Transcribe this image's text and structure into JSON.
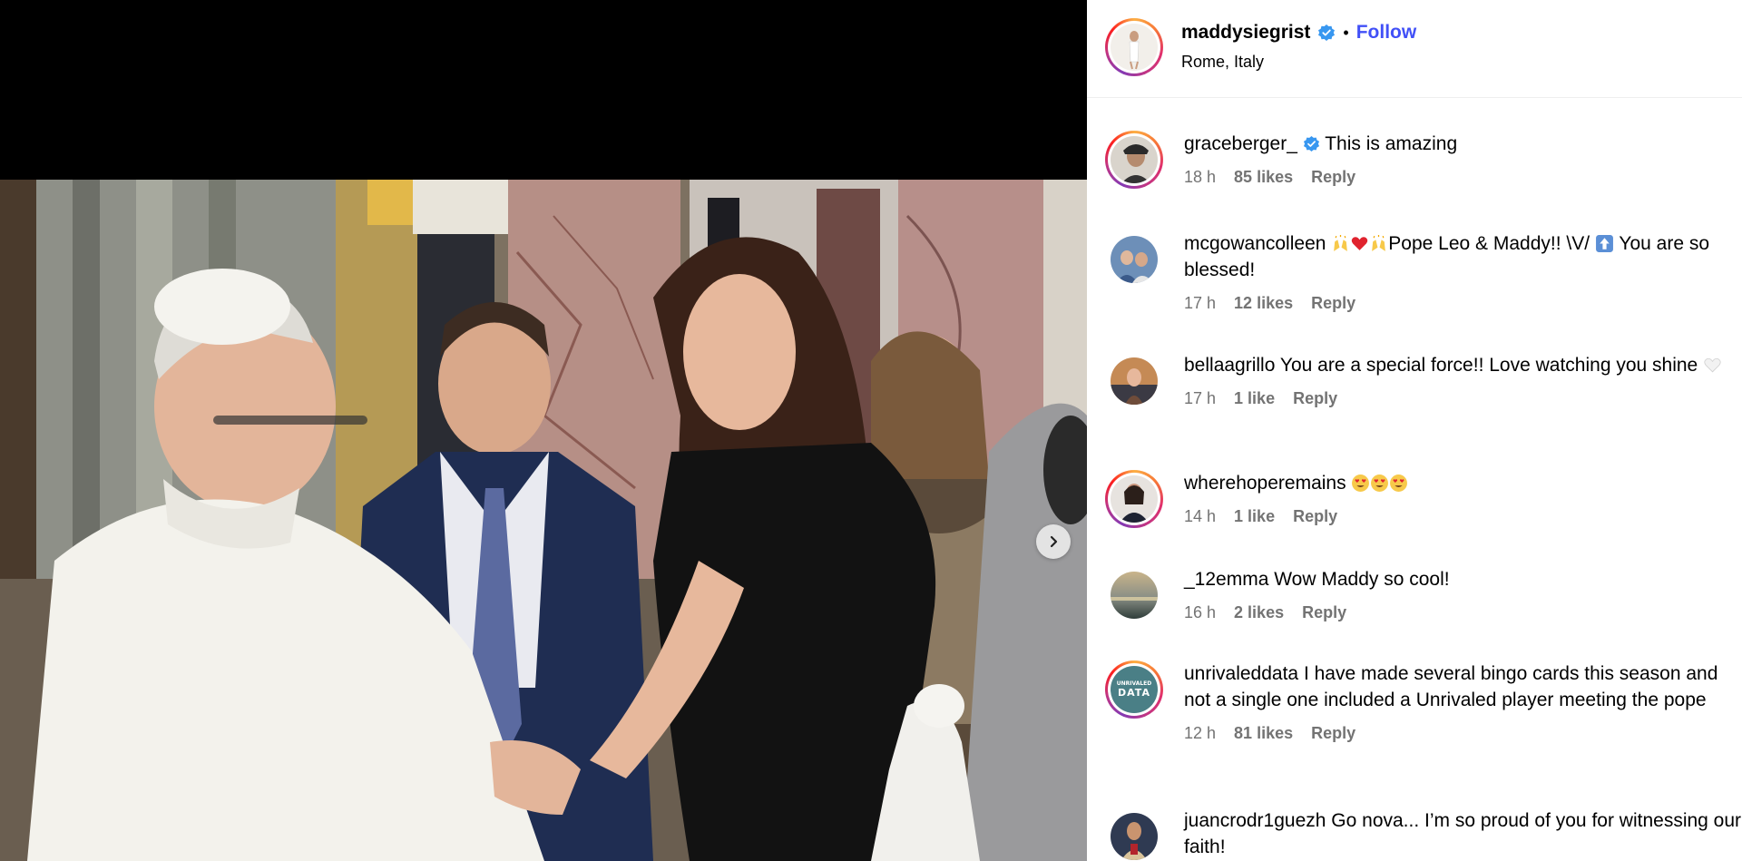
{
  "post": {
    "username": "maddysiegrist",
    "verified": true,
    "follow_label": "Follow",
    "separator": "•",
    "location": "Rome, Italy",
    "next_icon": "chevron-right-icon"
  },
  "comments": [
    {
      "username": "graceberger_",
      "verified": true,
      "text": "This is amazing",
      "time": "18 h",
      "likes": "85 likes",
      "reply": "Reply"
    },
    {
      "username": "mcgowancolleen",
      "verified": false,
      "pre_emoji": [
        "raising-hands",
        "red-heart",
        "raising-hands"
      ],
      "text": "Pope Leo & Maddy!! \\V/",
      "post_emoji": [
        "up-arrow"
      ],
      "text2": "You are so blessed!",
      "time": "17 h",
      "likes": "12 likes",
      "reply": "Reply"
    },
    {
      "username": "bellaagrillo",
      "verified": false,
      "text": "You are a special force!! Love watching you shine",
      "post_emoji": [
        "white-heart"
      ],
      "time": "17 h",
      "likes": "1 like",
      "reply": "Reply"
    },
    {
      "username": "wherehoperemains",
      "verified": false,
      "text": "",
      "post_emoji": [
        "heart-eyes",
        "heart-eyes",
        "heart-eyes"
      ],
      "time": "14 h",
      "likes": "1 like",
      "reply": "Reply"
    },
    {
      "username": "_12emma",
      "verified": false,
      "text": "Wow Maddy so cool!",
      "time": "16 h",
      "likes": "2 likes",
      "reply": "Reply"
    },
    {
      "username": "unrivaleddata",
      "verified": false,
      "text": "I have made several bingo cards this season and not a single one included a Unrivaled player meeting the pope",
      "avatar_text": [
        "UNRIVALED",
        "DATA"
      ],
      "time": "12 h",
      "likes": "81 likes",
      "reply": "Reply"
    },
    {
      "username": "juancrodr1guezh",
      "verified": false,
      "text": "Go nova... I’m so proud of you for witnessing our faith!",
      "time": "",
      "likes": "",
      "reply": ""
    }
  ],
  "colors": {
    "follow": "#4150f7",
    "verified": "#3897f0",
    "meta": "#737373",
    "media_bg": "#000000"
  }
}
